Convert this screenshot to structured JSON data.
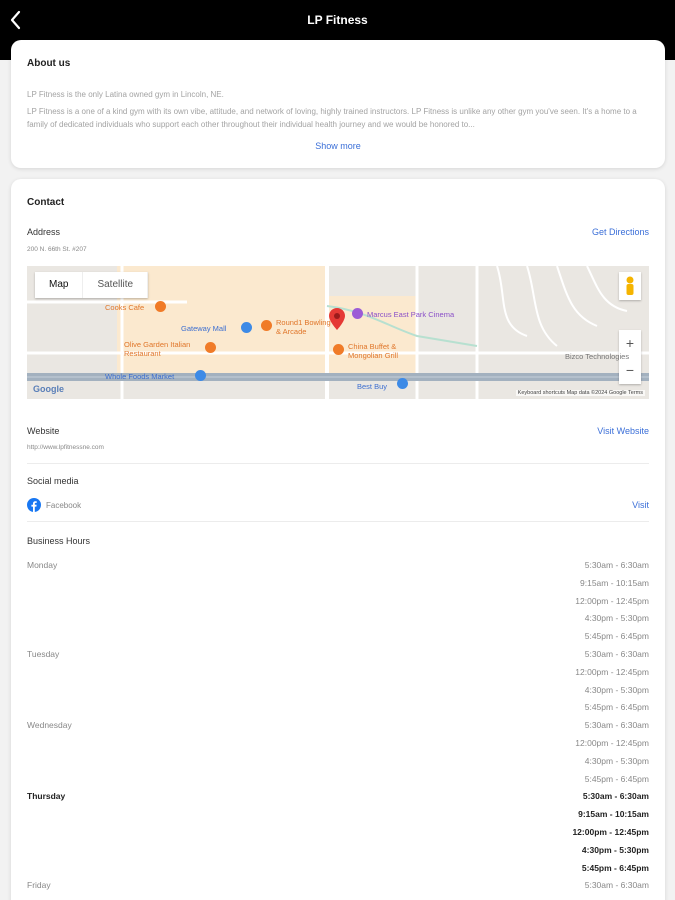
{
  "header": {
    "title": "LP Fitness"
  },
  "about": {
    "heading": "About us",
    "intro": "LP Fitness is the only Latina owned gym in Lincoln, NE.",
    "body": "LP Fitness is a one of a kind gym with its own vibe, attitude, and network of loving, highly trained instructors. LP Fitness is unlike any other gym you've seen. It's a home to a family of dedicated individuals who support each other throughout their individual health journey and we would be honored to...",
    "show_more": "Show more"
  },
  "contact": {
    "heading": "Contact",
    "address_label": "Address",
    "address": "200 N. 66th St. #207",
    "directions": "Get Directions",
    "website_label": "Website",
    "website_url": "http://www.lpfitnessne.com",
    "visit_website": "Visit Website",
    "social_label": "Social media",
    "facebook": "Facebook",
    "visit": "Visit"
  },
  "map": {
    "tab_map": "Map",
    "tab_satellite": "Satellite",
    "zoom_in": "+",
    "zoom_out": "−",
    "labels": {
      "cooks": "Cooks Cafe",
      "gateway": "Gateway Mall",
      "round1": "Round1 Bowling & Arcade",
      "marcus": "Marcus East Park Cinema",
      "olive": "Olive Garden Italian Restaurant",
      "china": "China Buffet & Mongolian Grill",
      "wholefoods": "Whole Foods Market",
      "bestbuy": "Best Buy",
      "bizco": "Bizco Technologies",
      "google": "Google",
      "attribution": "Keyboard shortcuts   Map data ©2024 Google   Terms"
    }
  },
  "hours": {
    "heading": "Business Hours",
    "days": [
      {
        "day": "Monday",
        "slots": [
          "5:30am - 6:30am",
          "9:15am - 10:15am",
          "12:00pm - 12:45pm",
          "4:30pm - 5:30pm",
          "5:45pm - 6:45pm"
        ]
      },
      {
        "day": "Tuesday",
        "slots": [
          "5:30am - 6:30am",
          "12:00pm - 12:45pm",
          "4:30pm - 5:30pm",
          "5:45pm - 6:45pm"
        ]
      },
      {
        "day": "Wednesday",
        "slots": [
          "5:30am - 6:30am",
          "12:00pm - 12:45pm",
          "4:30pm - 5:30pm",
          "5:45pm - 6:45pm"
        ]
      },
      {
        "day": "Thursday",
        "slots": [
          "5:30am - 6:30am",
          "9:15am - 10:15am",
          "12:00pm - 12:45pm",
          "4:30pm - 5:30pm",
          "5:45pm - 6:45pm"
        ]
      },
      {
        "day": "Friday",
        "slots": [
          "5:30am - 6:30am"
        ]
      }
    ]
  },
  "colors": {
    "accent": "#3b6fd8",
    "header_bg": "#000000",
    "poi_orange": "#f07b28",
    "poi_blue": "#3d8ae6",
    "pin_red": "#e53935"
  }
}
